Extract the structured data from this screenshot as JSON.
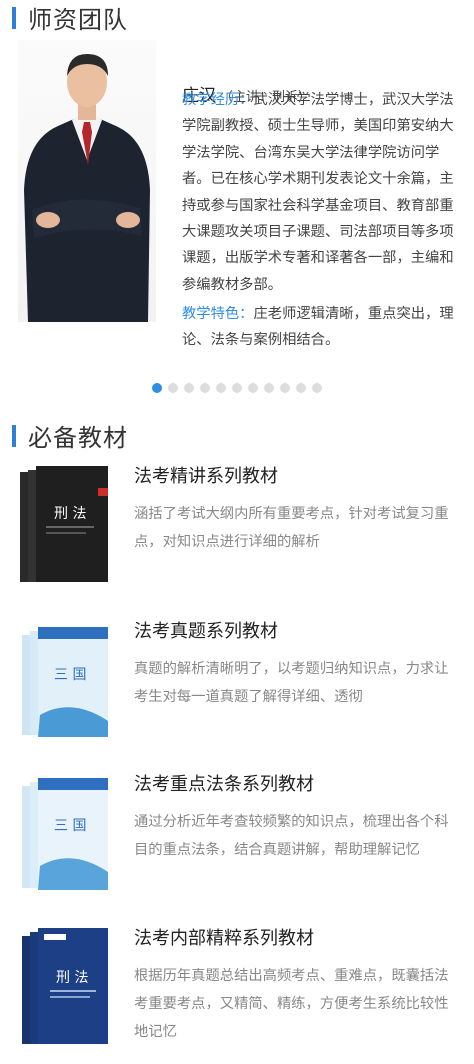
{
  "teachers_section": {
    "title": "师资团队"
  },
  "teacher": {
    "name": "庄汉",
    "role": "（主讲：刑诉）",
    "experience_label": "教学经历：",
    "experience_text": "武汉大学法学博士，武汉大学法学院副教授、硕士生导师，美国印第安纳大学法学院、台湾东吴大学法律学院访问学者。已在核心学术期刊发表论文十余篇，主持或参与国家社会科学基金项目、教育部重大课题攻关项目子课题、司法部项目等多项课题，出版学术专著和译著各一部，主编和参编教材多部。",
    "feature_label": "教学特色：",
    "feature_text": "庄老师逻辑清晰，重点突出，理论、法条与案例相结合。"
  },
  "carousel": {
    "total": 11,
    "active_index": 0
  },
  "books_section": {
    "title": "必备教材"
  },
  "books": [
    {
      "title": "法考精讲系列教材",
      "desc": "涵括了考试大纲内所有重要考点，针对考试复习重点，对知识点进行详细的解析",
      "cover_text": "刑  法",
      "cover_color": "#1f1f1f"
    },
    {
      "title": "法考真题系列教材",
      "desc": "真题的解析清晰明了，以考题归纳知识点，力求让考生对每一道真题了解得详细、透彻",
      "cover_text": "三  国",
      "cover_color": "#d9ecf8"
    },
    {
      "title": "法考重点法条系列教材",
      "desc": "通过分析近年考查较频繁的知识点，梳理出各个科目的重点法条，结合真题讲解，帮助理解记忆",
      "cover_text": "三  国",
      "cover_color": "#e4f1fa"
    },
    {
      "title": "法考内部精粹系列教材",
      "desc": "根据历年真题总结出高频考点、重难点，既囊括法考重要考点，又精简、精练，方便考生系统比较性地记忆",
      "cover_text": "刑  法",
      "cover_color": "#1d3f86"
    }
  ]
}
